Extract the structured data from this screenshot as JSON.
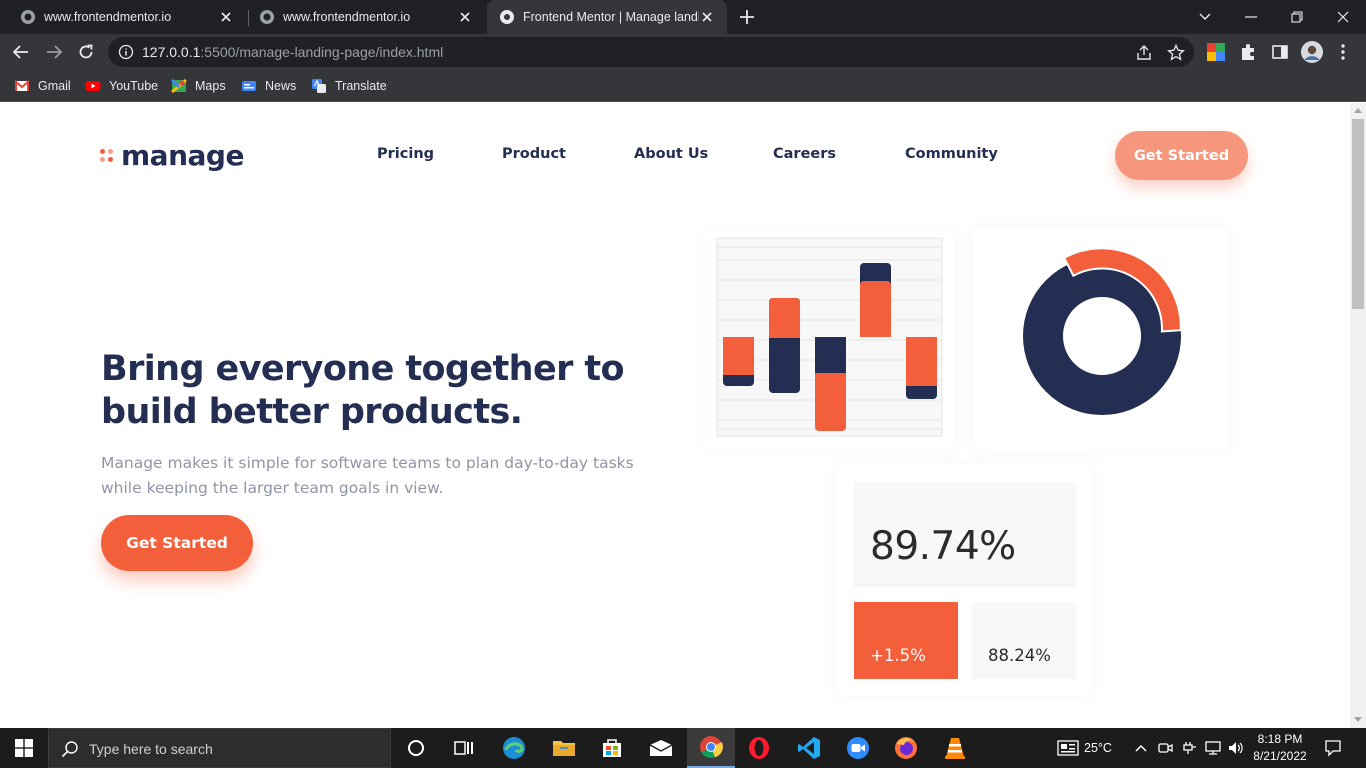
{
  "browser": {
    "tabs": [
      {
        "title": "www.frontendmentor.io",
        "active": false
      },
      {
        "title": "www.frontendmentor.io",
        "active": false
      },
      {
        "title": "Frontend Mentor | Manage landi",
        "active": true
      }
    ],
    "url_host": "127.0.0.1",
    "url_rest": ":5500/manage-landing-page/index.html",
    "bookmarks": [
      "Gmail",
      "YouTube",
      "Maps",
      "News",
      "Translate"
    ]
  },
  "page": {
    "logo_text": "manage",
    "nav": [
      "Pricing",
      "Product",
      "About Us",
      "Careers",
      "Community"
    ],
    "header_cta": "Get Started",
    "hero_title": "Bring everyone together to build better products.",
    "hero_text": "Manage makes it simple for software teams to plan day-to-day tasks while keeping the larger team goals in view.",
    "hero_cta": "Get Started",
    "stats": {
      "main": "89.74%",
      "change": "+1.5%",
      "secondary": "88.24%"
    },
    "colors": {
      "orange": "#f25f3a",
      "navy": "#242d52",
      "light_orange": "#f6977d"
    }
  },
  "taskbar": {
    "search_placeholder": "Type here to search",
    "weather": "25°C",
    "time": "8:18 PM",
    "date": "8/21/2022"
  }
}
